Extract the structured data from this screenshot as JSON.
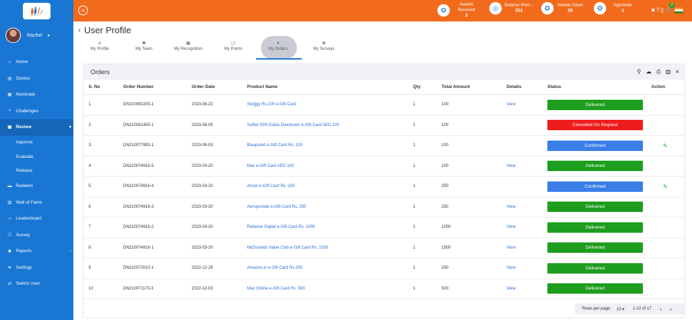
{
  "sidebar": {
    "user_name": "Rachel",
    "items": [
      {
        "label": "Home",
        "icon": "home-icon"
      },
      {
        "label": "Stories",
        "icon": "stories-icon"
      },
      {
        "label": "Nominate",
        "icon": "nominate-icon"
      },
      {
        "label": "Challenges",
        "icon": "challenges-icon"
      },
      {
        "label": "Review",
        "icon": "review-icon"
      },
      {
        "label": "Approve"
      },
      {
        "label": "Evaluate"
      },
      {
        "label": "Release"
      },
      {
        "label": "Redeem",
        "icon": "redeem-icon"
      },
      {
        "label": "Wall of Fame",
        "icon": "wall-of-fame-icon"
      },
      {
        "label": "Leaderboard",
        "icon": "leaderboard-icon"
      },
      {
        "label": "Survey",
        "icon": "survey-icon"
      },
      {
        "label": "Reports",
        "icon": "reports-icon"
      },
      {
        "label": "Settings",
        "icon": "settings-icon"
      },
      {
        "label": "Switch User",
        "icon": "switch-user-icon"
      }
    ]
  },
  "topbar": {
    "stats": [
      {
        "label": "Awards Received",
        "value": "3"
      },
      {
        "label": "Balance iPoin...",
        "value": "251"
      },
      {
        "label": "Awards Given",
        "value": "59"
      },
      {
        "label": "Approvals",
        "value": "1"
      }
    ],
    "cart_count": "2"
  },
  "page": {
    "title": "User Profile"
  },
  "tabs": [
    {
      "label": "My Profile",
      "icon": "person-icon"
    },
    {
      "label": "My Team",
      "icon": "team-icon"
    },
    {
      "label": "My Recognition",
      "icon": "recognition-icon"
    },
    {
      "label": "My Points",
      "icon": "points-icon"
    },
    {
      "label": "My Orders",
      "icon": "cart-icon"
    },
    {
      "label": "My Surveys",
      "icon": "survey-icon"
    }
  ],
  "orders": {
    "title": "Orders",
    "columns": [
      "S. No",
      "Order Number",
      "Order Date",
      "Product Name",
      "Qty",
      "Total Amount",
      "Details",
      "Status",
      "Action"
    ],
    "rows": [
      {
        "sno": "1",
        "order": "DN210082205-1",
        "date": "2023-08-22",
        "product": "Swiggy Rs.100 e-Gift Card",
        "qty": "1",
        "amount": "100",
        "details": "View",
        "status": "Delivered",
        "status_type": "delivered",
        "edit": false
      },
      {
        "sno": "2",
        "order": "DN210081405-1",
        "date": "2023-08-05",
        "product": "Sofitel SPA Dubai Downtown e-Gift Card AED 100",
        "qty": "1",
        "amount": "100",
        "details": "",
        "status": "Cancelled On Request",
        "status_type": "cancelled",
        "edit": false
      },
      {
        "sno": "3",
        "order": "DN210077993-1",
        "date": "2023-06-03",
        "product": "Blaupunkt e-Gift Card Rs. 100",
        "qty": "1",
        "amount": "100",
        "details": "",
        "status": "Confirmed",
        "status_type": "confirmed",
        "edit": true
      },
      {
        "sno": "4",
        "order": "DN210074916-5",
        "date": "2023-03-20",
        "product": "Max e-Gift Card AED 100",
        "qty": "1",
        "amount": "100",
        "details": "View",
        "status": "Delivered",
        "status_type": "delivered",
        "edit": false
      },
      {
        "sno": "5",
        "order": "DN210074916-4",
        "date": "2023-03-20",
        "product": "Arrow e-Gift Card Rs. 250",
        "qty": "1",
        "amount": "250",
        "details": "",
        "status": "Confirmed",
        "status_type": "confirmed",
        "edit": true
      },
      {
        "sno": "6",
        "order": "DN210074916-3",
        "date": "2023-03-20",
        "product": "Aeropostale e-Gift Card Rs. 250",
        "qty": "1",
        "amount": "250",
        "details": "View",
        "status": "Delivered",
        "status_type": "delivered",
        "edit": false
      },
      {
        "sno": "7",
        "order": "DN210074916-2",
        "date": "2023-03-20",
        "product": "Reliance Digital e-Gift Card Rs. 1000",
        "qty": "1",
        "amount": "1000",
        "details": "View",
        "status": "Delivered",
        "status_type": "delivered",
        "edit": false
      },
      {
        "sno": "8",
        "order": "DN210074916-1",
        "date": "2023-03-20",
        "product": "McDonalds Value Club e-Gift Card Rs. 1500",
        "qty": "1",
        "amount": "1500",
        "details": "View",
        "status": "Delivered",
        "status_type": "delivered",
        "edit": false
      },
      {
        "sno": "9",
        "order": "DN210072010-1",
        "date": "2022-12-28",
        "product": "Amazon.in e-Gift Card Rs.250",
        "qty": "1",
        "amount": "250",
        "details": "View",
        "status": "Delivered",
        "status_type": "delivered",
        "edit": false
      },
      {
        "sno": "10",
        "order": "DN210071173-3",
        "date": "2022-12-03",
        "product": "Max Online e-Gift Card Rs. 500",
        "qty": "1",
        "amount": "500",
        "details": "View",
        "status": "Delivered",
        "status_type": "delivered",
        "edit": false
      }
    ]
  },
  "pagination": {
    "rows_per_page_label": "Rows per page:",
    "rows_per_page": "10",
    "range": "1-10 of 17"
  }
}
